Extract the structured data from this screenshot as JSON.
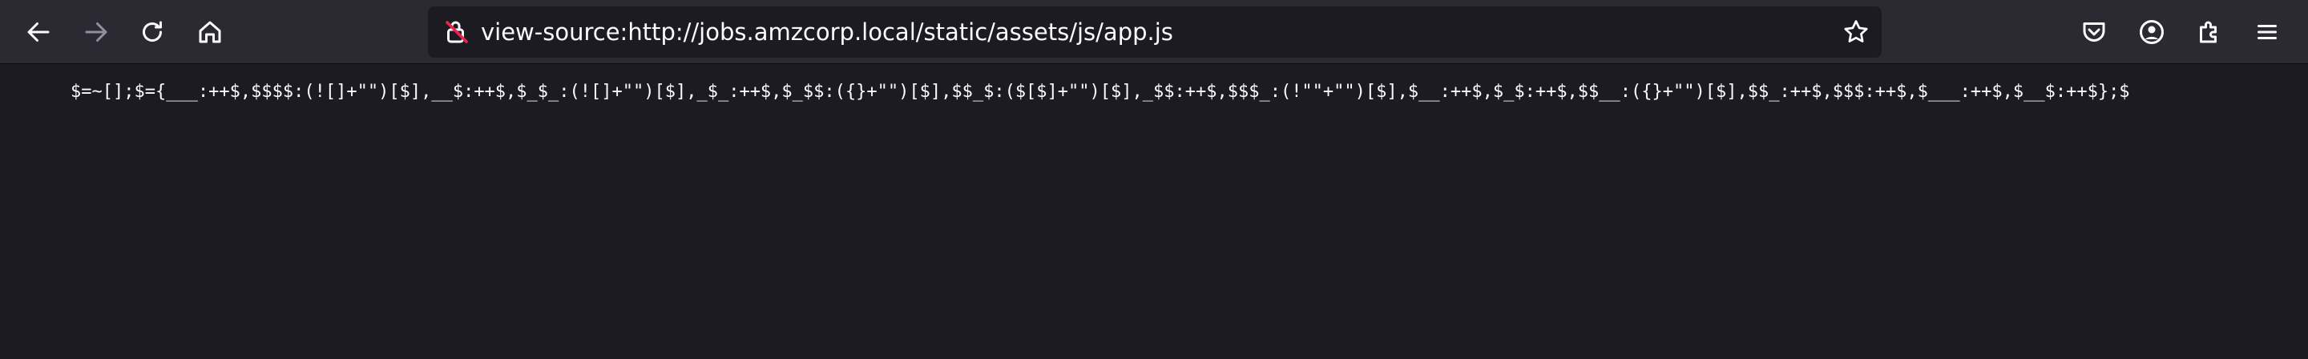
{
  "toolbar": {
    "back": {
      "icon": "back-arrow-icon"
    },
    "forward": {
      "icon": "forward-arrow-icon"
    },
    "reload": {
      "icon": "reload-icon"
    },
    "home": {
      "icon": "home-icon"
    },
    "url": "view-source:http://jobs.amzcorp.local/static/assets/js/app.js",
    "bookmark_icon": "star-icon",
    "pocket_icon": "pocket-icon",
    "account_icon": "account-icon",
    "extensions_icon": "extensions-icon",
    "menu_icon": "hamburger-menu-icon"
  },
  "source": {
    "line_1": "$=~[];$={___:++$,$$$$:(![]+\"\")[$],__$:++$,$_$_:(![]+\"\")[$],_$_:++$,$_$$:({}+\"\")[$],$$_$:($[$]+\"\")[$],_$$:++$,$$$_:(!\"\"+\"\")[$],$__:++$,$_$:++$,$$__:({}+\"\")[$],$$_:++$,$$$:++$,$___:++$,$__$:++$};$"
  },
  "colors": {
    "toolbar_bg": "#2b2a33",
    "page_bg": "#1c1b22",
    "text": "#fbfbfe",
    "lock_accent": "#e22850"
  }
}
